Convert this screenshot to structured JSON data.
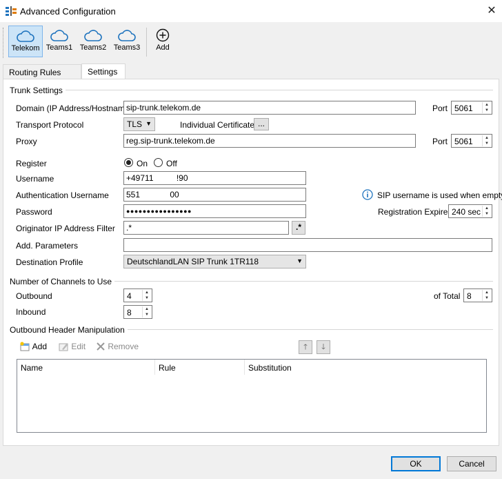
{
  "window": {
    "title": "Advanced Configuration"
  },
  "toolbar": {
    "items": [
      {
        "label": "Telekom",
        "icon": "cloud-icon",
        "active": true
      },
      {
        "label": "Teams1",
        "icon": "cloud-icon"
      },
      {
        "label": "Teams2",
        "icon": "cloud-icon"
      },
      {
        "label": "Teams3",
        "icon": "cloud-icon"
      }
    ],
    "add_label": "Add"
  },
  "tabs": [
    {
      "label": "Routing Rules (SIP)"
    },
    {
      "label": "Settings",
      "active": true
    }
  ],
  "trunk": {
    "section": "Trunk Settings",
    "domain_label": "Domain (IP Address/Hostname)",
    "domain_value": "sip-trunk.telekom.de",
    "port_label": "Port",
    "domain_port": "5061",
    "transport_label": "Transport Protocol",
    "transport_value": "TLS",
    "cert_label": "Individual Certificate",
    "cert_button": "...",
    "proxy_label": "Proxy",
    "proxy_value": "reg.sip-trunk.telekom.de",
    "proxy_port": "5061",
    "register_label": "Register",
    "register_on": "On",
    "register_off": "Off",
    "username_label": "Username",
    "username_value": "+49711          !90",
    "auth_label": "Authentication Username",
    "auth_value": "551             00",
    "info_text": "SIP username is used when empty.",
    "password_label": "Password",
    "password_value": "●●●●●●●●●●●●●●●●",
    "reg_expires_label": "Registration Expires",
    "reg_expires_value": "240 sec",
    "filter_label": "Originator IP Address Filter",
    "filter_value": ".*",
    "filter_button": ".*",
    "params_label": "Add. Parameters",
    "params_value": "",
    "profile_label": "Destination Profile",
    "profile_value": "DeutschlandLAN SIP Trunk 1TR118"
  },
  "channels": {
    "section": "Number of Channels to Use",
    "outbound_label": "Outbound",
    "outbound_value": "4",
    "inbound_label": "Inbound",
    "inbound_value": "8",
    "total_label": "of Total",
    "total_value": "8"
  },
  "headers": {
    "section": "Outbound Header Manipulation",
    "add": "Add",
    "edit": "Edit",
    "remove": "Remove",
    "columns": [
      "Name",
      "Rule",
      "Substitution"
    ]
  },
  "footer": {
    "ok": "OK",
    "cancel": "Cancel"
  },
  "colors": {
    "accent": "#0078d7",
    "cloud": "#1e73be",
    "selected_bg": "#cce4f7"
  }
}
